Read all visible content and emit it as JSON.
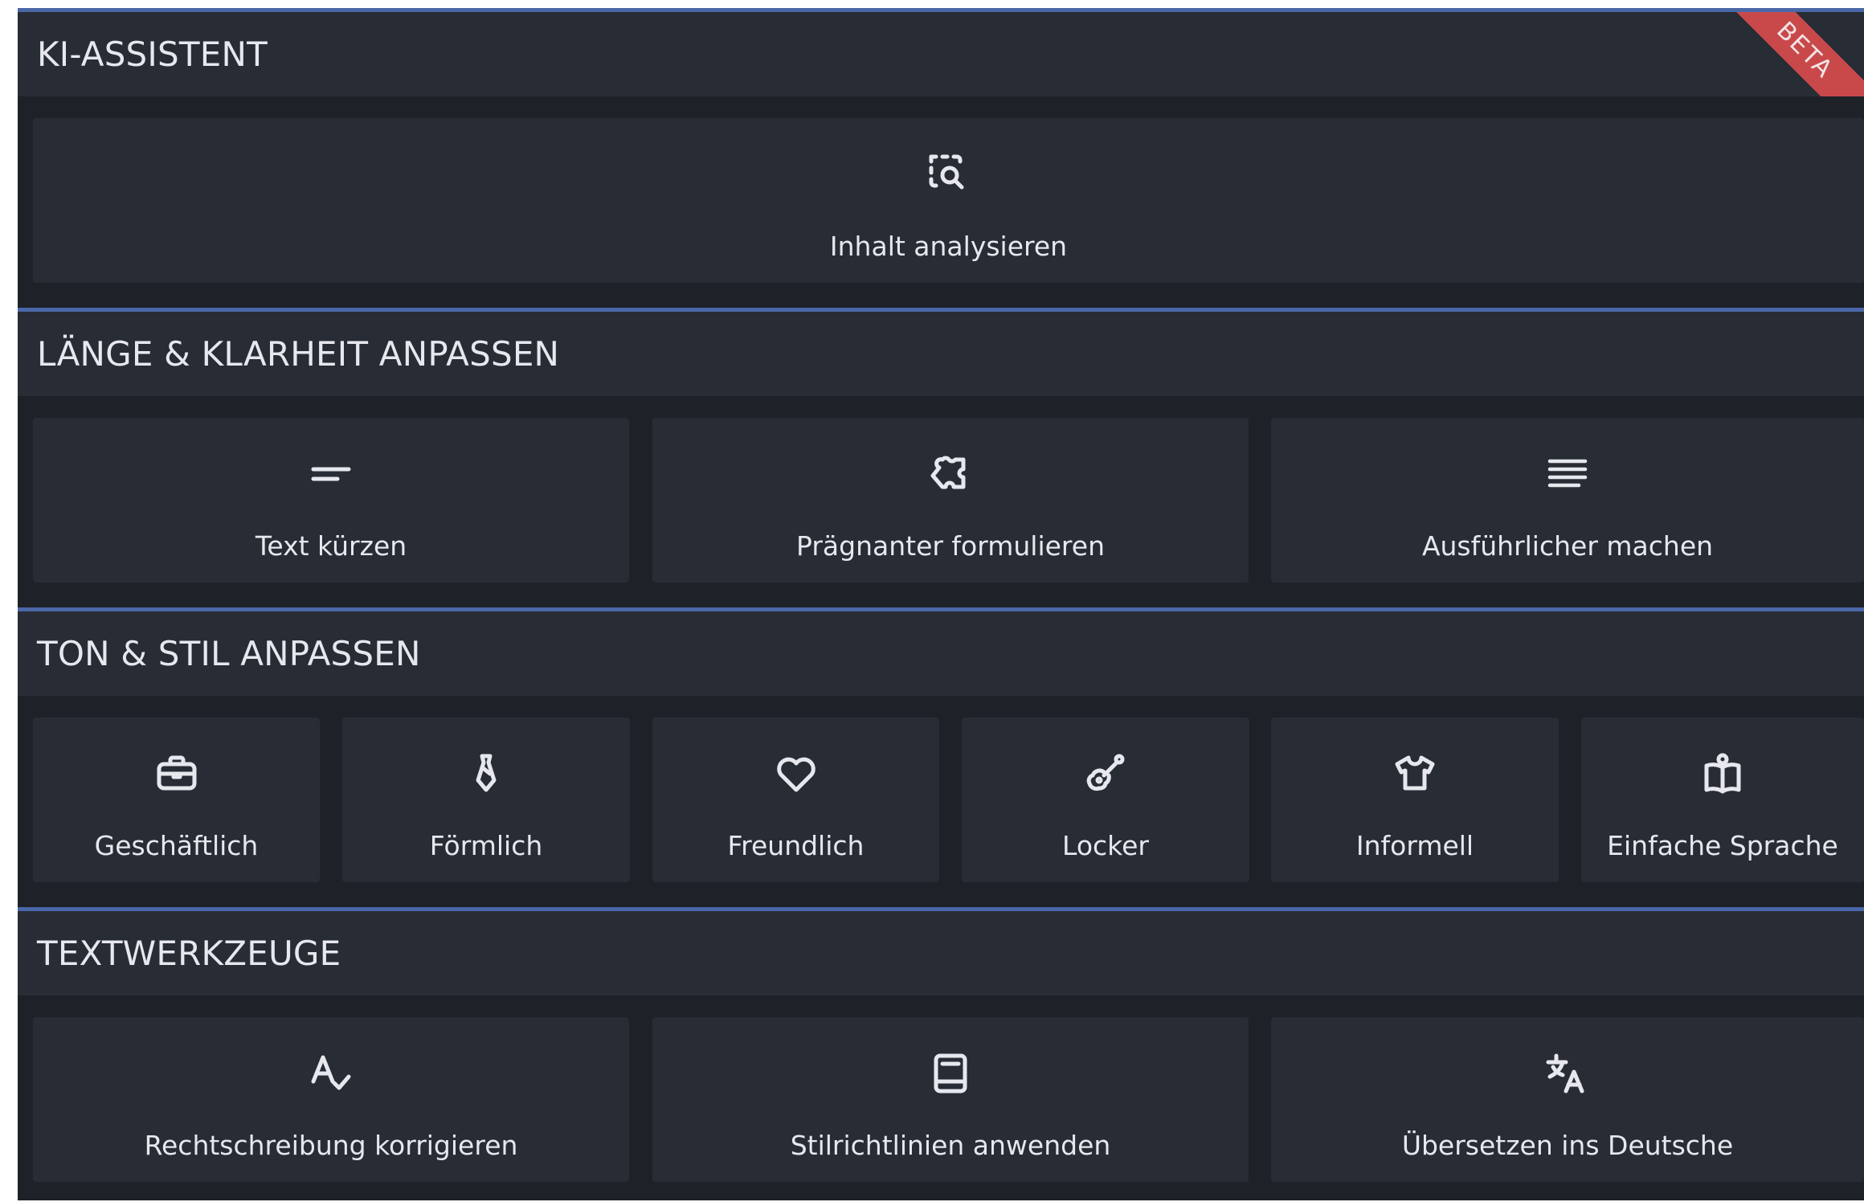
{
  "sections": [
    {
      "title": "KI-ASSISTENT",
      "badge": "BETA",
      "tiles": [
        {
          "label": "Inhalt analysieren",
          "icon": "analyze-search-icon"
        }
      ]
    },
    {
      "title": "LÄNGE & KLARHEIT ANPASSEN",
      "tiles": [
        {
          "label": "Text kürzen",
          "icon": "short-text-icon"
        },
        {
          "label": "Prägnanter formulieren",
          "icon": "puzzle-piece-icon"
        },
        {
          "label": "Ausführlicher machen",
          "icon": "long-text-icon"
        }
      ]
    },
    {
      "title": "TON & STIL ANPASSEN",
      "tiles": [
        {
          "label": "Geschäftlich",
          "icon": "briefcase-icon"
        },
        {
          "label": "Förmlich",
          "icon": "necktie-icon"
        },
        {
          "label": "Freundlich",
          "icon": "heart-icon"
        },
        {
          "label": "Locker",
          "icon": "guitar-icon"
        },
        {
          "label": "Informell",
          "icon": "tshirt-icon"
        },
        {
          "label": "Einfache Sprache",
          "icon": "open-book-icon"
        }
      ]
    },
    {
      "title": "TEXTWERKZEUGE",
      "tiles": [
        {
          "label": "Rechtschreibung korrigieren",
          "icon": "spellcheck-icon"
        },
        {
          "label": "Stilrichtlinien anwenden",
          "icon": "style-guide-book-icon"
        },
        {
          "label": "Übersetzen ins Deutsche",
          "icon": "translate-icon"
        }
      ]
    }
  ],
  "colors": {
    "background": "#1e2128",
    "tile": "#282c35",
    "accent_line": "#4a67a8",
    "text": "#e6e8ee",
    "beta_ribbon": "#c9494b"
  }
}
